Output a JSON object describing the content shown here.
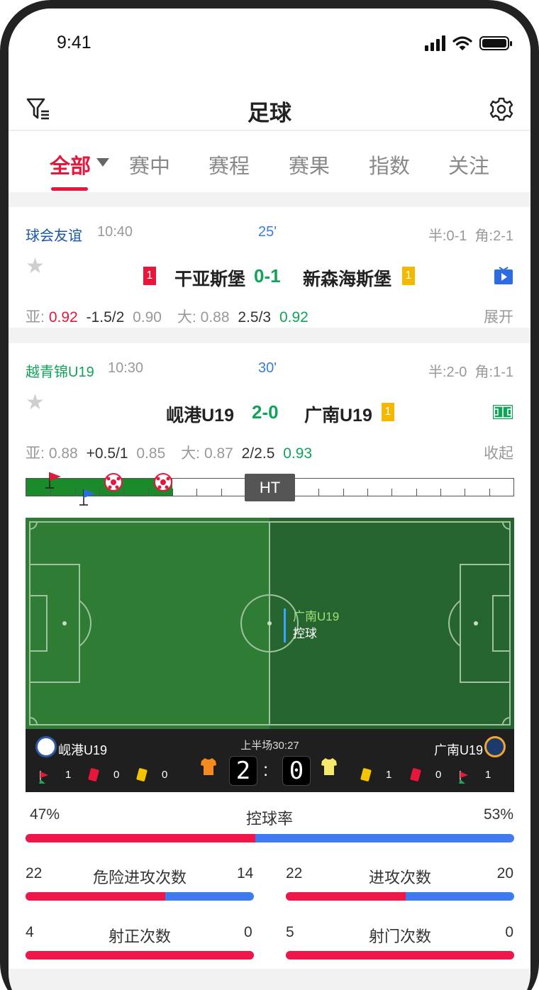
{
  "status_bar": {
    "time": "9:41"
  },
  "header": {
    "title": "足球"
  },
  "tabs": [
    {
      "label": "全部",
      "active": true
    },
    {
      "label": "赛中"
    },
    {
      "label": "赛程"
    },
    {
      "label": "赛果"
    },
    {
      "label": "指数"
    },
    {
      "label": "关注"
    }
  ],
  "colors": {
    "accent": "#e8163b",
    "score_green": "#11a35a",
    "minute_blue": "#3b7ed6",
    "home_bar": "#f0164a",
    "away_bar": "#3f7bf0"
  },
  "matches": [
    {
      "league": "球会友谊",
      "league_color": "#1a56a8",
      "kickoff": "10:40",
      "minute": "25'",
      "half": "半:0-1",
      "corner": "角:2-1",
      "home_red": "1",
      "home": "干亚斯堡",
      "score": "0-1",
      "away": "新森海斯堡",
      "away_yellow": "1",
      "media_icon": "tv-icon",
      "odds": {
        "asia_label": "亚:",
        "asia_home": "0.92",
        "asia_line": "-1.5/2",
        "asia_away": "0.90",
        "ou_label": "大:",
        "ou_over": "0.88",
        "ou_line": "2.5/3",
        "ou_under": "0.92"
      },
      "toggle": "展开"
    },
    {
      "league": "越青锦U19",
      "league_color": "#11a35a",
      "kickoff": "10:30",
      "minute": "30'",
      "half": "半:2-0",
      "corner": "角:1-1",
      "home": "岘港U19",
      "score": "2-0",
      "away": "广南U19",
      "away_yellow": "1",
      "media_icon": "pitch-icon",
      "odds": {
        "asia_label": "亚:",
        "asia_home": "0.88",
        "asia_line": "+0.5/1",
        "asia_away": "0.85",
        "ou_label": "大:",
        "ou_over": "0.87",
        "ou_line": "2/2.5",
        "ou_under": "0.93"
      },
      "toggle": "收起",
      "timeline": {
        "half_marker": "HT",
        "progress_fraction": 0.3
      },
      "pitch": {
        "possession_team": "广南U19",
        "possession_text": "控球"
      },
      "scoreboard": {
        "home": "岘港U19",
        "away": "广南U19",
        "period": "上半场30:27",
        "home_score": "2",
        "away_score": "0",
        "home_stats": {
          "corners": "1",
          "red": "0",
          "yellow": "0"
        },
        "away_stats": {
          "yellow": "1",
          "red": "0",
          "corners": "1"
        }
      },
      "stats": {
        "possession": {
          "label": "控球率",
          "home": "47%",
          "away": "53%",
          "home_value": 47,
          "away_value": 53
        },
        "dangerous_attacks": {
          "label": "危险进攻次数",
          "home": "22",
          "away": "14",
          "home_value": 22,
          "away_value": 14
        },
        "attacks": {
          "label": "进攻次数",
          "home": "22",
          "away": "20",
          "home_value": 22,
          "away_value": 20
        },
        "shots_on_target": {
          "label": "射正次数",
          "home": "4",
          "away": "0",
          "home_value": 4,
          "away_value": 0
        },
        "shots": {
          "label": "射门次数",
          "home": "5",
          "away": "0",
          "home_value": 5,
          "away_value": 0
        }
      }
    }
  ]
}
